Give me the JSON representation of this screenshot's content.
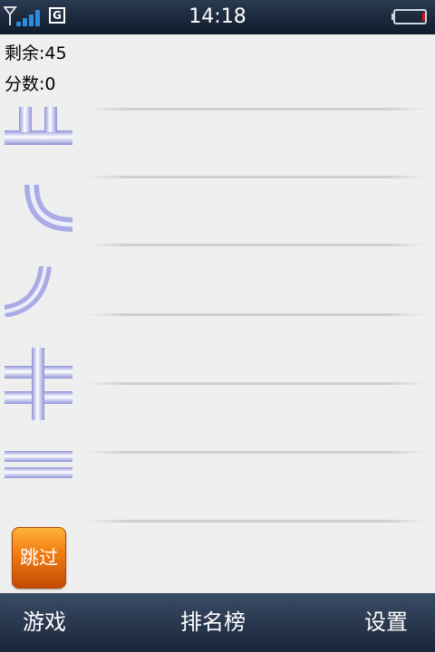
{
  "status_bar": {
    "time": "14:18",
    "network_type": "G",
    "signal_icon": "signal-bars-icon",
    "battery_icon": "battery-low-icon",
    "battery_level_color": "#d01818"
  },
  "game": {
    "remaining_text": "剩余:45",
    "score_text": "分数:0",
    "tiles": [
      {
        "shape": "tee-up-pipe",
        "icon": "tee-pipe-icon"
      },
      {
        "shape": "curve-top-right-pipe",
        "icon": "curve-pipe-icon"
      },
      {
        "shape": "curve-bottom-left-pipe",
        "icon": "curve-pipe-icon"
      },
      {
        "shape": "cross-pipe",
        "icon": "cross-pipe-icon"
      },
      {
        "shape": "straight-horizontal-pipe",
        "icon": "straight-pipe-icon"
      }
    ],
    "skip_label": "跳过",
    "pipe_color": "#a9abe6"
  },
  "bottom_nav": {
    "game": "游戏",
    "leaderboard": "排名榜",
    "settings": "设置"
  }
}
